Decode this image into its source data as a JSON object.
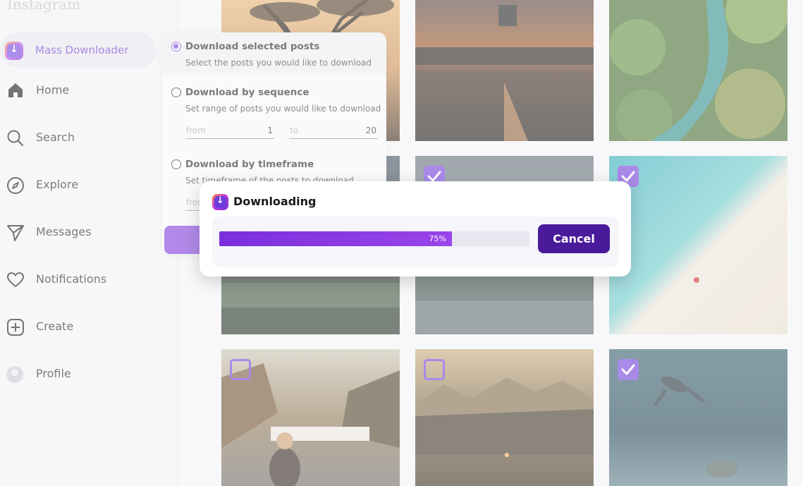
{
  "app": {
    "brand": "Instagram"
  },
  "sidebar": {
    "active": {
      "label": "Mass Downloader",
      "icon": "download-arrow-icon"
    },
    "items": [
      {
        "label": "Home",
        "icon": "home-icon"
      },
      {
        "label": "Search",
        "icon": "search-icon"
      },
      {
        "label": "Explore",
        "icon": "compass-icon"
      },
      {
        "label": "Messages",
        "icon": "send-icon"
      },
      {
        "label": "Notifications",
        "icon": "heart-icon"
      },
      {
        "label": "Create",
        "icon": "plus-square-icon"
      },
      {
        "label": "Profile",
        "icon": "avatar"
      }
    ]
  },
  "options": {
    "selected": {
      "title": "Download selected posts",
      "desc": "Select the posts you would like to download"
    },
    "sequence": {
      "title": "Download by sequence",
      "desc": "Set range of posts you would like to download",
      "from_placeholder": "from",
      "from_value": "1",
      "to_placeholder": "to",
      "to_value": "20"
    },
    "timeframe": {
      "title": "Download by timeframe",
      "desc": "Set timeframe of the posts to download",
      "from_placeholder": "from"
    }
  },
  "modal": {
    "title": "Downloading",
    "progress": 75,
    "progress_label": "75%",
    "cancel_label": "Cancel"
  },
  "grid": {
    "checked": [
      false,
      false,
      false,
      false,
      true,
      true,
      false,
      false,
      true
    ]
  },
  "colors": {
    "accent": "#6c36d8",
    "cancel": "#4a1a9a",
    "progress": "#8a3be3"
  }
}
